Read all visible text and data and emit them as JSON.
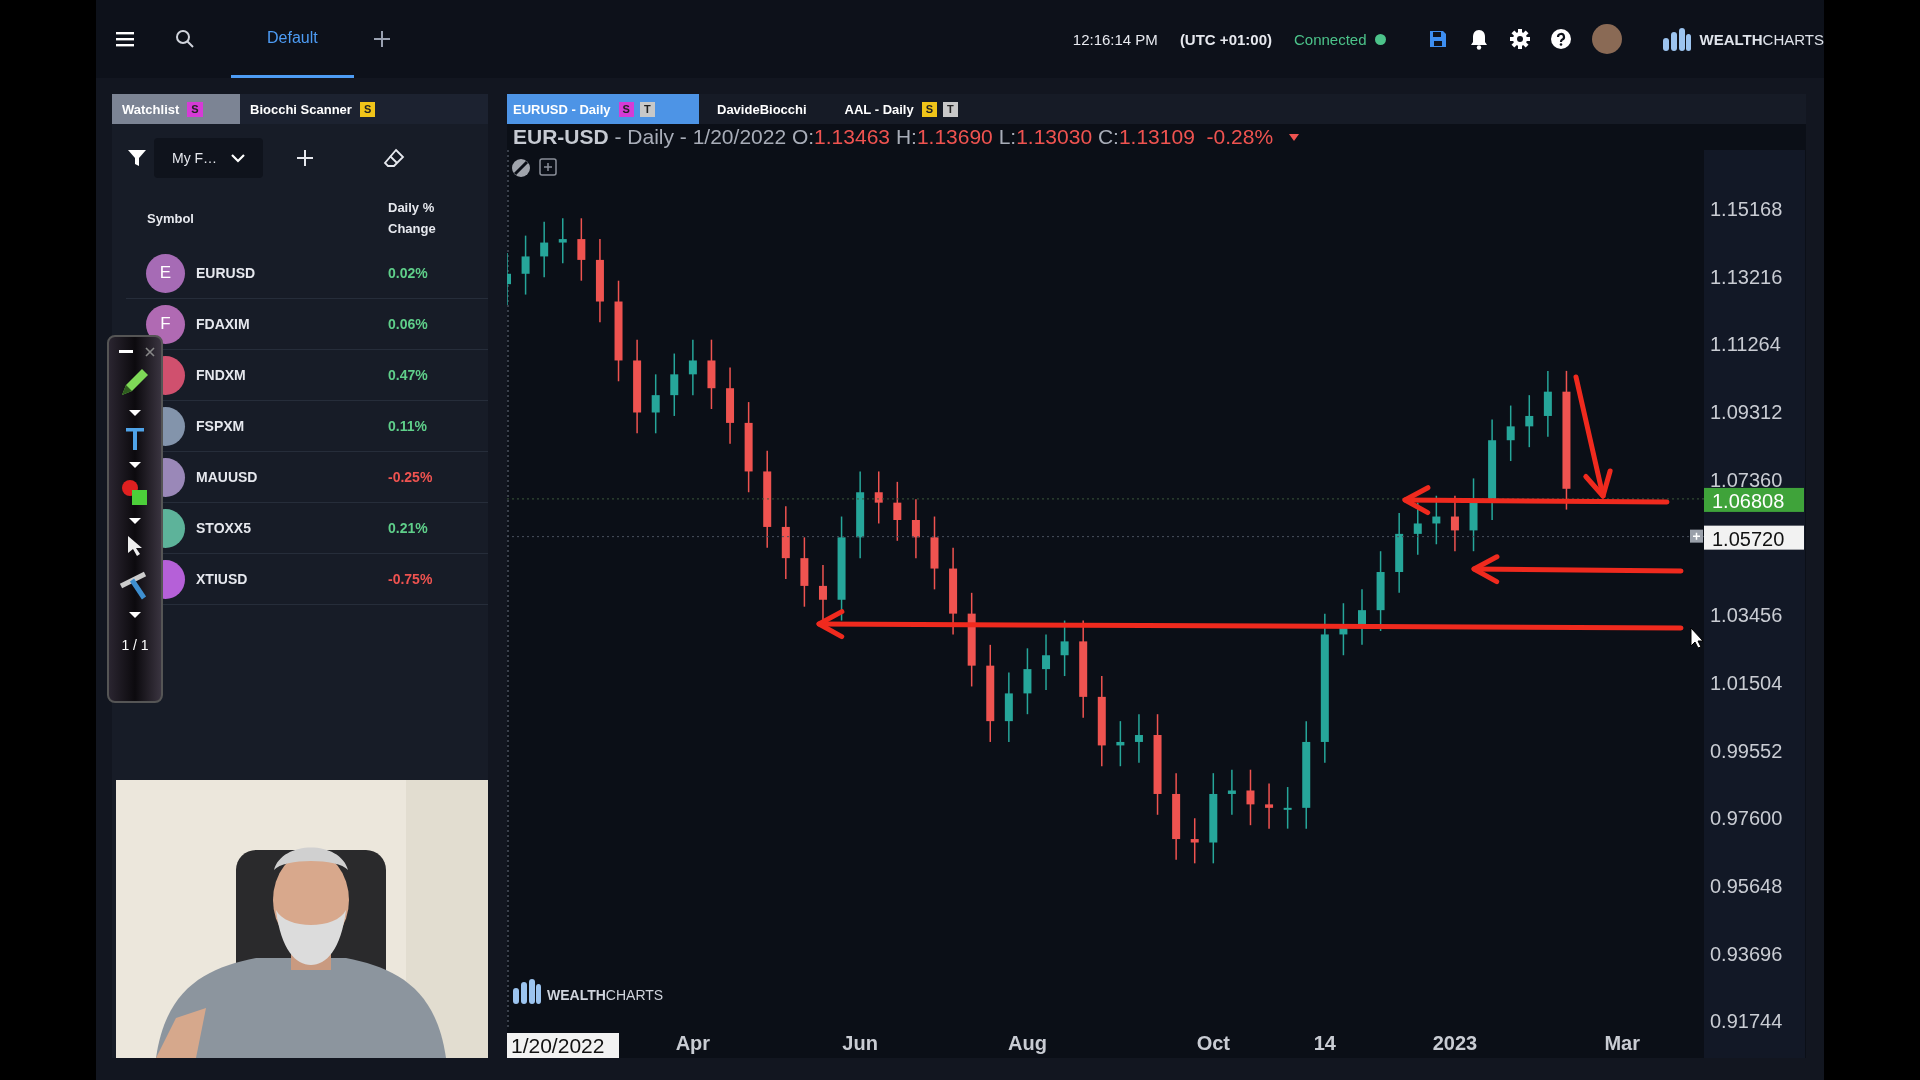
{
  "topbar": {
    "tabs": [
      {
        "label": "Default",
        "selected": true
      }
    ],
    "time": "12:16:14 PM",
    "timezone": "(UTC +01:00)",
    "connection": {
      "label": "Connected",
      "on": true
    },
    "logo": "**WEALTH**CHARTS"
  },
  "watchlist": {
    "tabs": [
      {
        "label": "Watchlist",
        "selected": true,
        "badges": [
          {
            "text": "S",
            "color": "#d63bd6"
          }
        ]
      },
      {
        "label": "Biocchi Scanner",
        "selected": false,
        "badges": [
          {
            "text": "S",
            "color": "#f0c419"
          }
        ]
      }
    ],
    "filter": "My F…",
    "columns": [
      "Symbol",
      "Daily % Change"
    ],
    "rows": [
      {
        "letter": "E",
        "color": "#a66bb5",
        "symbol": "EURUSD",
        "change": {
          "text": "0.02%",
          "color": "#5fcf8a"
        }
      },
      {
        "letter": "F",
        "color": "#b06ab3",
        "symbol": "FDAXIM",
        "change": {
          "text": "0.06%",
          "color": "#5fcf8a"
        }
      },
      {
        "color": "#d0506e",
        "symbol": "FNDXM",
        "change": {
          "text": "0.47%",
          "color": "#5fcf8a"
        }
      },
      {
        "color": "#8394ab",
        "symbol": "FSPXM",
        "change": {
          "text": "0.11%",
          "color": "#5fcf8a"
        }
      },
      {
        "color": "#9a88b8",
        "symbol": "MAUUSD",
        "change": {
          "text": "-0.25%",
          "color": "#ef5350"
        }
      },
      {
        "color": "#5db39a",
        "symbol": "STOXX5",
        "change": {
          "text": "0.21%",
          "color": "#5fcf8a"
        }
      },
      {
        "color": "#b560d8",
        "symbol": "XTIUSD",
        "change": {
          "text": "-0.75%",
          "color": "#ef5350"
        }
      }
    ]
  },
  "pen_toolbar": {
    "page": "1 / 1"
  },
  "chart": {
    "tabs": [
      {
        "label": "EURUSD - Daily",
        "selected": true,
        "badges": [
          {
            "text": "S",
            "color": "#d63bd6"
          },
          {
            "text": "T",
            "color": "#c8c8c8"
          }
        ]
      },
      {
        "label": "DavideBiocchi",
        "selected": false
      },
      {
        "label": "AAL - Daily",
        "selected": false,
        "badges": [
          {
            "text": "S",
            "color": "#f0c419"
          },
          {
            "text": "T",
            "color": "#c8c8c8"
          }
        ]
      }
    ],
    "header": {
      "symbol": "EUR-USD",
      "details": " - Daily - 1/20/2022",
      "color": "#ef5350",
      "ohlc": [
        {
          "label": "O:",
          "value": "1.13463"
        },
        {
          "label": "H:",
          "value": "1.13690"
        },
        {
          "label": "L:",
          "value": "1.13030"
        },
        {
          "label": "C:",
          "value": "1.13109"
        }
      ],
      "change": "-0.28%"
    },
    "chart_data": {
      "type": "candlestick",
      "categories": [
        null,
        null,
        null,
        null,
        null,
        null,
        null,
        null,
        null,
        null,
        "Apr",
        null,
        null,
        null,
        null,
        null,
        null,
        null,
        null,
        "Jun",
        null,
        null,
        null,
        null,
        null,
        null,
        null,
        null,
        "Aug",
        null,
        null,
        null,
        null,
        null,
        null,
        null,
        null,
        null,
        "Oct",
        null,
        null,
        null,
        null,
        null,
        "14",
        null,
        null,
        null,
        null,
        null,
        null,
        "2023",
        null,
        null,
        null,
        null,
        null,
        null,
        null,
        null,
        "Mar",
        null,
        null
      ],
      "ohlc": [
        [
          1.13,
          1.139,
          1.124,
          1.133
        ],
        [
          1.133,
          1.144,
          1.127,
          1.138
        ],
        [
          1.138,
          1.148,
          1.132,
          1.142
        ],
        [
          1.142,
          1.149,
          1.136,
          1.143
        ],
        [
          1.143,
          1.149,
          1.131,
          1.137
        ],
        [
          1.137,
          1.143,
          1.119,
          1.125
        ],
        [
          1.125,
          1.131,
          1.102,
          1.108
        ],
        [
          1.108,
          1.114,
          1.087,
          1.093
        ],
        [
          1.093,
          1.104,
          1.087,
          1.098
        ],
        [
          1.098,
          1.11,
          1.092,
          1.104
        ],
        [
          1.104,
          1.114,
          1.098,
          1.108
        ],
        [
          1.108,
          1.114,
          1.094,
          1.1
        ],
        [
          1.1,
          1.106,
          1.084,
          1.09
        ],
        [
          1.09,
          1.096,
          1.07,
          1.076
        ],
        [
          1.076,
          1.082,
          1.054,
          1.06
        ],
        [
          1.06,
          1.066,
          1.045,
          1.051
        ],
        [
          1.051,
          1.057,
          1.037,
          1.043
        ],
        [
          1.043,
          1.049,
          1.033,
          1.039
        ],
        [
          1.039,
          1.063,
          1.033,
          1.057
        ],
        [
          1.057,
          1.076,
          1.051,
          1.07
        ],
        [
          1.07,
          1.076,
          1.061,
          1.067
        ],
        [
          1.067,
          1.073,
          1.056,
          1.062
        ],
        [
          1.062,
          1.068,
          1.051,
          1.057
        ],
        [
          1.057,
          1.063,
          1.042,
          1.048
        ],
        [
          1.048,
          1.054,
          1.029,
          1.035
        ],
        [
          1.035,
          1.041,
          1.014,
          1.02
        ],
        [
          1.02,
          1.026,
          0.998,
          1.004
        ],
        [
          1.004,
          1.018,
          0.998,
          1.012
        ],
        [
          1.012,
          1.025,
          1.006,
          1.019
        ],
        [
          1.019,
          1.029,
          1.013,
          1.023
        ],
        [
          1.023,
          1.033,
          1.017,
          1.027
        ],
        [
          1.027,
          1.033,
          1.005,
          1.011
        ],
        [
          1.011,
          1.017,
          0.991,
          0.997
        ],
        [
          0.997,
          1.004,
          0.991,
          0.998
        ],
        [
          0.998,
          1.006,
          0.992,
          1.0
        ],
        [
          1.0,
          1.006,
          0.977,
          0.983
        ],
        [
          0.983,
          0.989,
          0.964,
          0.97
        ],
        [
          0.97,
          0.976,
          0.963,
          0.969
        ],
        [
          0.969,
          0.989,
          0.963,
          0.983
        ],
        [
          0.983,
          0.99,
          0.977,
          0.984
        ],
        [
          0.984,
          0.99,
          0.974,
          0.98
        ],
        [
          0.98,
          0.986,
          0.973,
          0.979
        ],
        [
          0.979,
          0.985,
          0.973,
          0.979
        ],
        [
          0.979,
          1.004,
          0.973,
          0.998
        ],
        [
          0.998,
          1.035,
          0.992,
          1.029
        ],
        [
          1.029,
          1.038,
          1.023,
          1.032
        ],
        [
          1.032,
          1.042,
          1.026,
          1.036
        ],
        [
          1.036,
          1.053,
          1.03,
          1.047
        ],
        [
          1.047,
          1.064,
          1.041,
          1.058
        ],
        [
          1.058,
          1.067,
          1.052,
          1.061
        ],
        [
          1.061,
          1.069,
          1.055,
          1.063
        ],
        [
          1.063,
          1.069,
          1.053,
          1.059
        ],
        [
          1.059,
          1.074,
          1.053,
          1.068
        ],
        [
          1.068,
          1.091,
          1.062,
          1.085
        ],
        [
          1.085,
          1.095,
          1.079,
          1.089
        ],
        [
          1.089,
          1.098,
          1.083,
          1.092
        ],
        [
          1.092,
          1.105,
          1.086,
          1.099
        ],
        [
          1.099,
          1.105,
          1.065,
          1.071
        ],
        null,
        null,
        null,
        null,
        null
      ],
      "ylim": [
        0.91494,
        1.16869
      ],
      "yticks": [
        {
          "value": 1.15168,
          "label": "1.15168"
        },
        {
          "value": 1.13216,
          "label": "1.13216"
        },
        {
          "value": 1.11264,
          "label": "1.11264"
        },
        {
          "value": 1.09312,
          "label": "1.09312"
        },
        {
          "value": 1.0736,
          "label": "1.07360"
        },
        {
          "value": 1.03456,
          "label": "1.03456"
        },
        {
          "value": 1.01504,
          "label": "1.01504"
        },
        {
          "value": 0.99552,
          "label": "0.99552"
        },
        {
          "value": 0.976,
          "label": "0.97600"
        },
        {
          "value": 0.95648,
          "label": "0.95648"
        },
        {
          "value": 0.93696,
          "label": "0.93696"
        },
        {
          "value": 0.91744,
          "label": "0.91744"
        }
      ]
    },
    "last_price": "1.06808",
    "crosshair_price": "1.05720",
    "crosshair_date": "1/20/2022",
    "watermark": "**WEALTH**CHARTS"
  }
}
